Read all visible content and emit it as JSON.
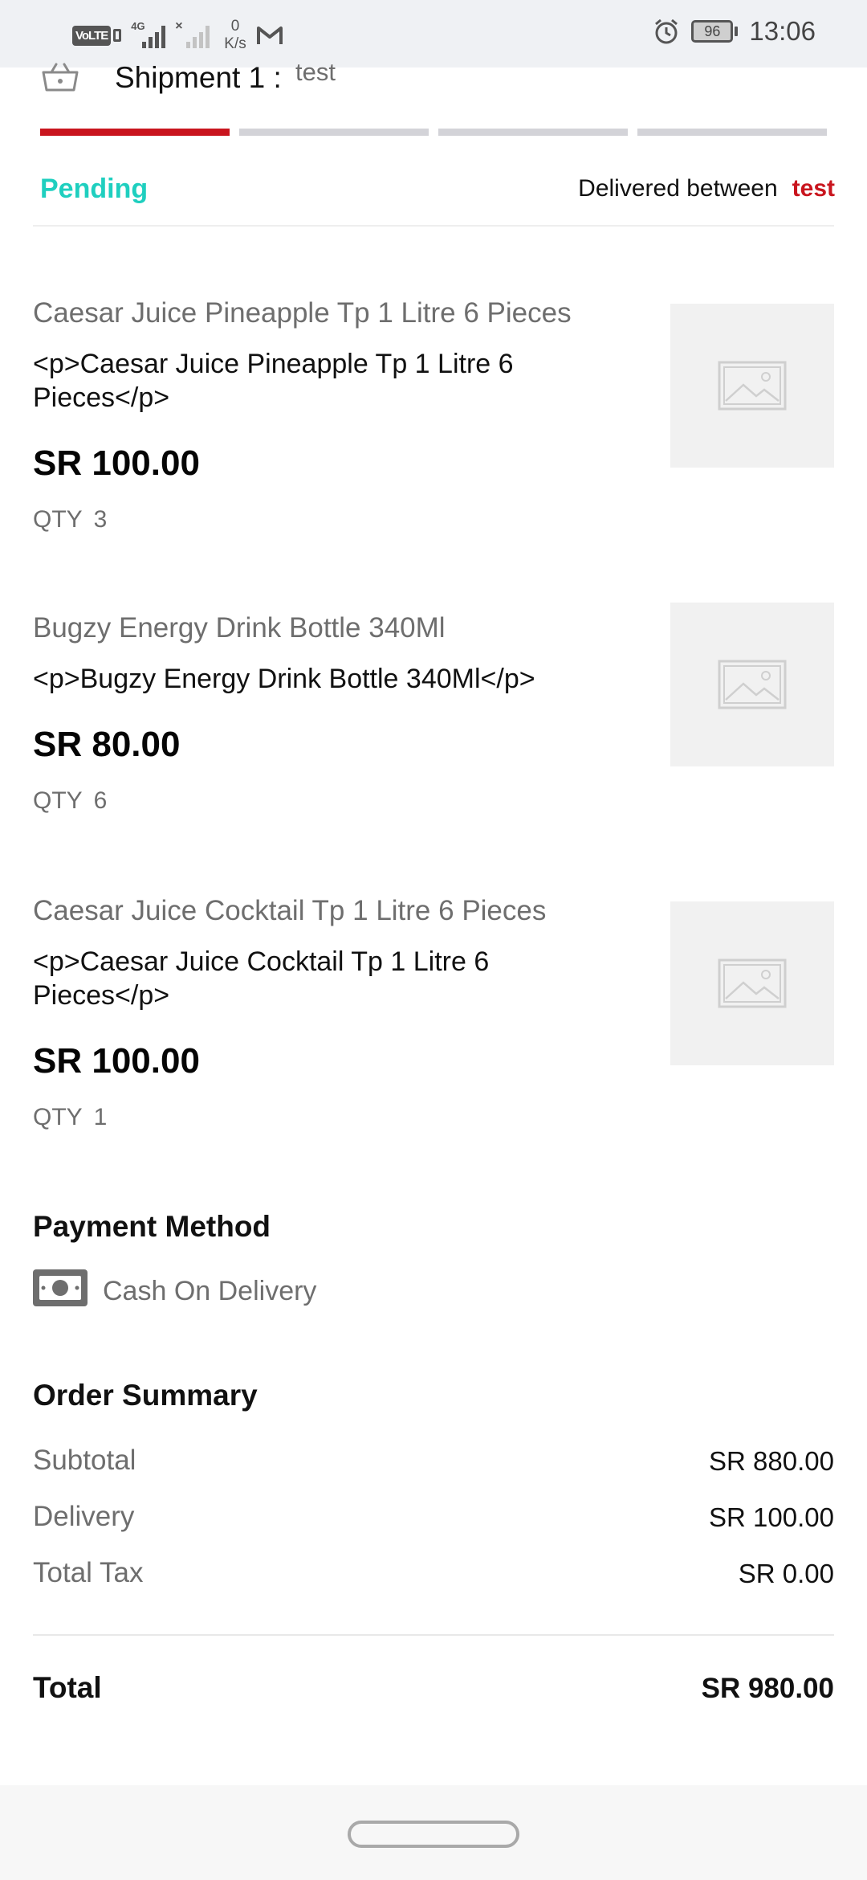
{
  "status_bar": {
    "volte": "VoLTE",
    "network": "4G",
    "speed_value": "0",
    "speed_unit": "K/s",
    "battery": "96",
    "time": "13:06",
    "icons": [
      "volte-icon",
      "signal-icon",
      "no-signal-icon",
      "gmail-icon",
      "alarm-icon",
      "battery-icon"
    ]
  },
  "shipment": {
    "title": "Shipment 1 :",
    "value": "test",
    "progress_steps": 4,
    "progress_active": 1,
    "status": "Pending",
    "delivered_label": "Delivered between",
    "delivered_value": "test"
  },
  "items": [
    {
      "name": "Caesar Juice Pineapple Tp 1 Litre 6 Pieces",
      "description": "<p>Caesar Juice Pineapple Tp 1 Litre 6 Pieces</p>",
      "price": "SR 100.00",
      "qty_label": "QTY",
      "qty": "3"
    },
    {
      "name": "Bugzy Energy Drink Bottle 340Ml",
      "description": "<p>Bugzy Energy Drink Bottle 340Ml</p>",
      "price": "SR 80.00",
      "qty_label": "QTY",
      "qty": "6"
    },
    {
      "name": "Caesar Juice Cocktail Tp 1 Litre 6 Pieces",
      "description": "<p>Caesar Juice Cocktail Tp 1 Litre 6 Pieces</p>",
      "price": "SR 100.00",
      "qty_label": "QTY",
      "qty": "1"
    }
  ],
  "payment": {
    "title": "Payment Method",
    "method": "Cash On Delivery"
  },
  "summary": {
    "title": "Order Summary",
    "rows": [
      {
        "label": "Subtotal",
        "amount": "SR 880.00"
      },
      {
        "label": "Delivery",
        "amount": "SR 100.00"
      },
      {
        "label": "Total Tax",
        "amount": "SR 0.00"
      }
    ],
    "total_label": "Total",
    "total_amount": "SR 980.00"
  },
  "colors": {
    "accent_red": "#c9151e",
    "status_teal": "#1fcfbf",
    "muted_text": "#6e6e6e"
  }
}
